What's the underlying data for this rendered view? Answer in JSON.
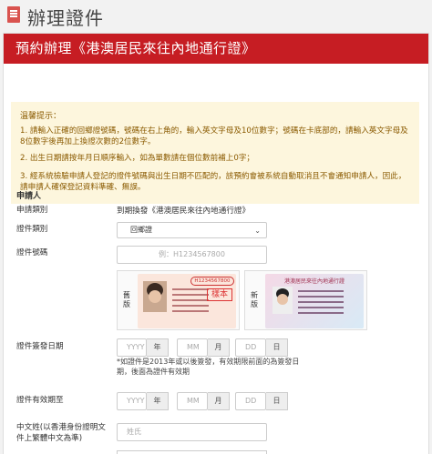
{
  "header": {
    "title": "辦理證件"
  },
  "panel": {
    "title": "預約辦理《港澳居民來往內地通行證》"
  },
  "notice": {
    "title": "溫馨提示：",
    "items": [
      "1. 請輸入正確的回鄉證號碼，號碼在右上角的，輸入英文字母及10位數字；號碼在卡底部的，請輸入英文字母及8位數字後再加上換證次數的2位數字。",
      "2. 出生日期請按年月日順序輸入，如為單數請在個位數前補上0字；",
      "3. 經系統檢驗申請人登記的證件號碼與出生日期不匹配的，該預約會被系統自動取消且不會通知申請人，因此，請申請人確保登記資料準確、無誤。"
    ]
  },
  "form": {
    "section_title": "申請人",
    "apply_type": {
      "label": "申請類別",
      "value": "到期換發《港澳居民來往內地通行證》"
    },
    "doc_type": {
      "label": "證件類別",
      "value": "回鄉證"
    },
    "doc_number": {
      "label": "證件號碼",
      "placeholder": "例：H1234567800"
    },
    "samples": {
      "old_label": "舊版",
      "new_label": "新版",
      "old_card_number": "H1234567800",
      "old_card_stamp": "樣本",
      "new_card_title": "港澳居民來往內地通行證"
    },
    "issue_date": {
      "label": "證件簽發日期",
      "year_placeholder": "YYYY",
      "year_unit": "年",
      "month_placeholder": "MM",
      "month_unit": "月",
      "day_placeholder": "DD",
      "day_unit": "日",
      "hint": "*如證件是2013年或以後簽發，有效期限前面的為簽發日期，後面為證件有效期"
    },
    "expiry_date": {
      "label": "證件有效期至",
      "year_placeholder": "YYYY",
      "year_unit": "年",
      "month_placeholder": "MM",
      "month_unit": "月",
      "day_placeholder": "DD",
      "day_unit": "日"
    },
    "chinese_name": {
      "label": "中文姓(以香港身份證明文件上繁體中文為準)",
      "placeholder": "姓氏"
    }
  },
  "colors": {
    "header_red": "#c61d23",
    "notice_bg": "#fdf6dd",
    "notice_text": "#8a5a00"
  }
}
